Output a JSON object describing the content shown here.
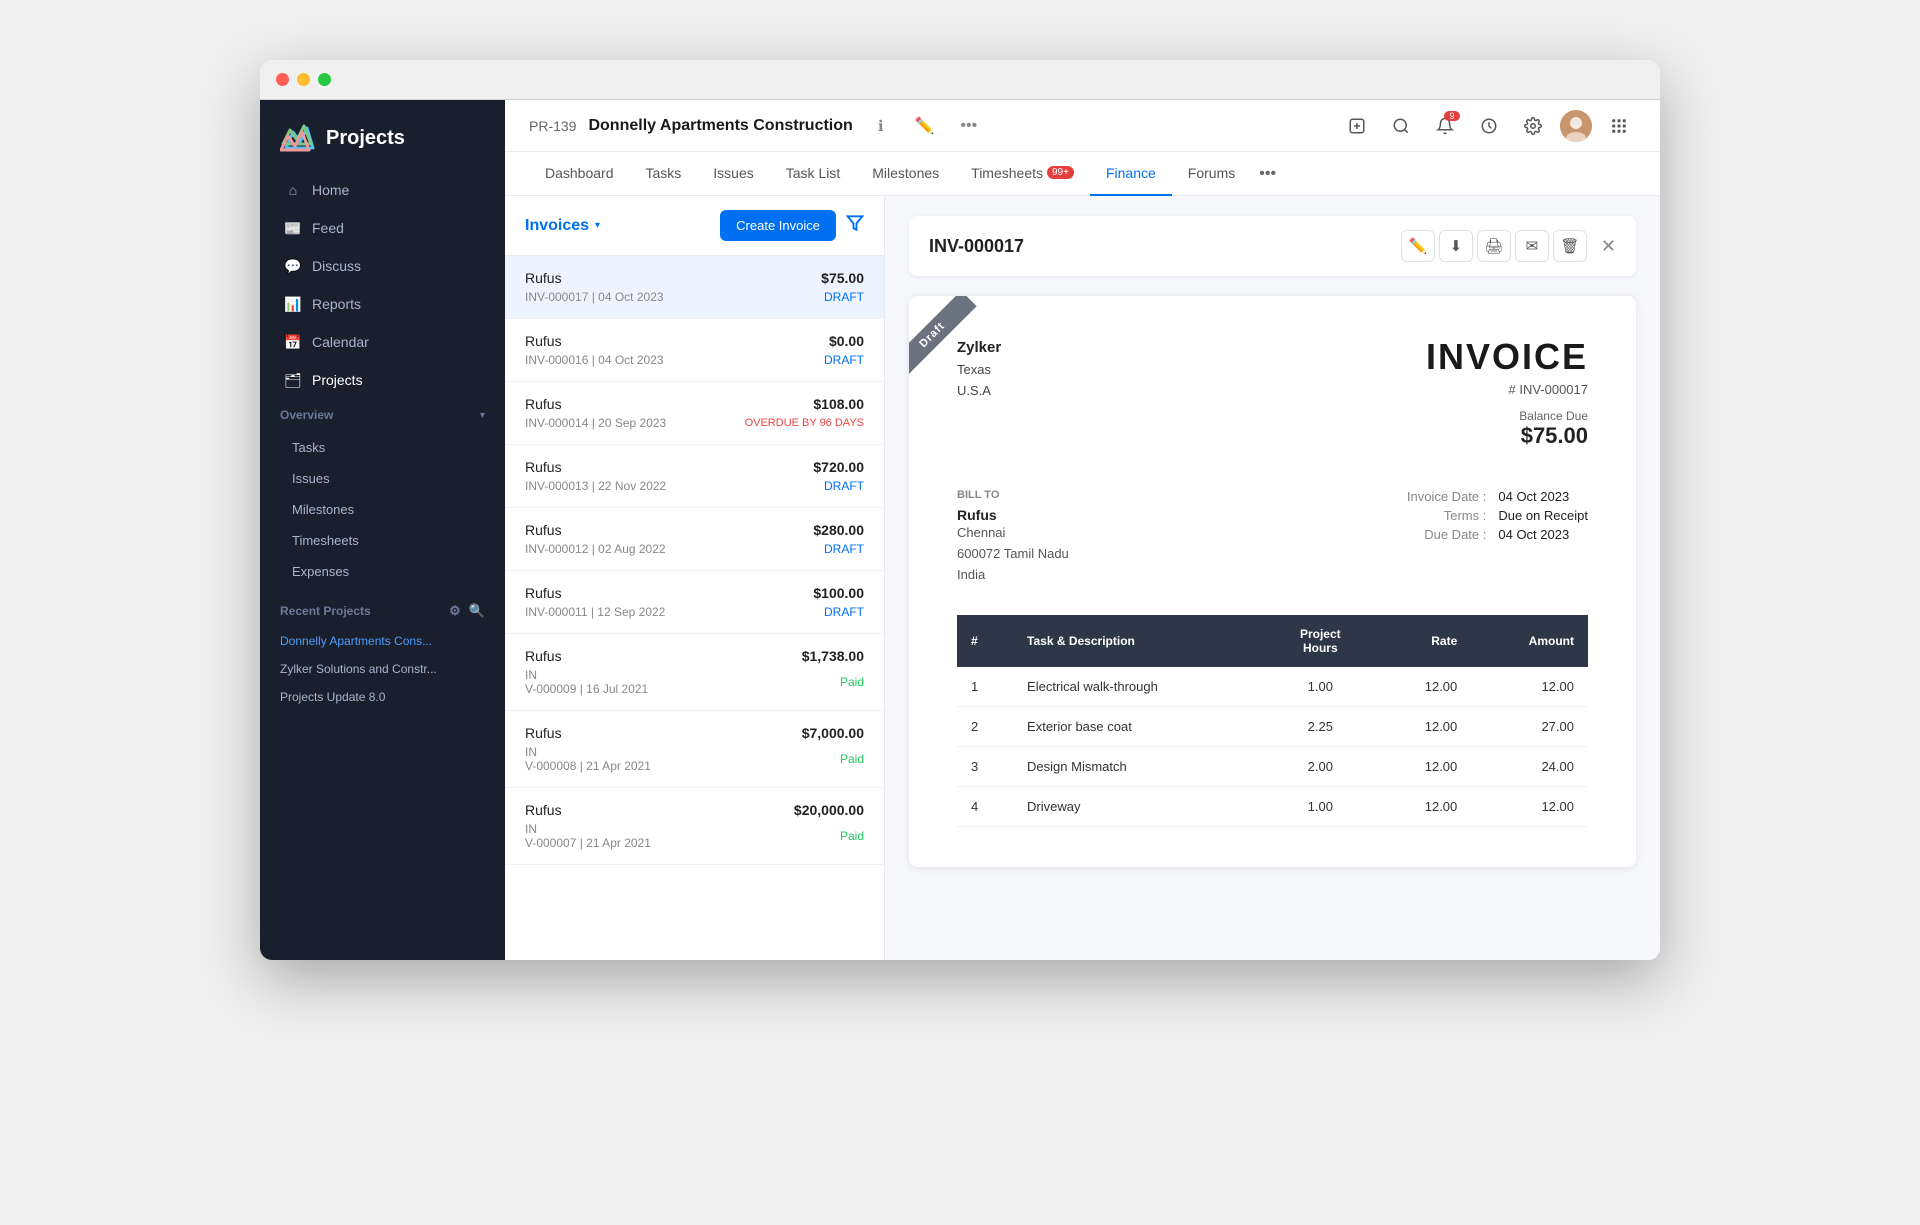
{
  "window": {
    "title": "Projects"
  },
  "sidebar": {
    "logo_text": "Projects",
    "nav_items": [
      {
        "id": "home",
        "label": "Home",
        "icon": "home"
      },
      {
        "id": "feed",
        "label": "Feed",
        "icon": "feed"
      },
      {
        "id": "discuss",
        "label": "Discuss",
        "icon": "discuss"
      },
      {
        "id": "reports",
        "label": "Reports",
        "icon": "reports"
      },
      {
        "id": "calendar",
        "label": "Calendar",
        "icon": "calendar"
      },
      {
        "id": "projects",
        "label": "Projects",
        "icon": "projects"
      }
    ],
    "overview_label": "Overview",
    "sub_nav": [
      {
        "label": "Tasks"
      },
      {
        "label": "Issues"
      },
      {
        "label": "Milestones"
      },
      {
        "label": "Timesheets"
      },
      {
        "label": "Expenses"
      }
    ],
    "recent_projects_label": "Recent Projects",
    "recent_projects": [
      {
        "label": "Donnelly Apartments Cons...",
        "active": true
      },
      {
        "label": "Zylker Solutions and Constr..."
      },
      {
        "label": "Projects Update 8.0"
      }
    ]
  },
  "header": {
    "project_code": "PR-139",
    "project_name": "Donnelly Apartments Construction",
    "tabs": [
      {
        "label": "Dashboard",
        "active": false
      },
      {
        "label": "Tasks",
        "active": false
      },
      {
        "label": "Issues",
        "active": false
      },
      {
        "label": "Task List",
        "active": false
      },
      {
        "label": "Milestones",
        "active": false
      },
      {
        "label": "Timesheets",
        "active": false,
        "badge": "99+"
      },
      {
        "label": "Finance",
        "active": true
      },
      {
        "label": "Forums",
        "active": false
      }
    ]
  },
  "finance": {
    "invoices_label": "Invoices",
    "create_invoice_btn": "Create Invoice",
    "invoices": [
      {
        "client": "Rufus",
        "ref": "INV-000017",
        "date": "04 Oct 2023",
        "amount": "$75.00",
        "status": "DRAFT",
        "status_type": "draft",
        "selected": true
      },
      {
        "client": "Rufus",
        "ref": "INV-000016",
        "date": "04 Oct 2023",
        "amount": "$0.00",
        "status": "DRAFT",
        "status_type": "draft",
        "selected": false
      },
      {
        "client": "Rufus",
        "ref": "INV-000014",
        "date": "20 Sep 2023",
        "amount": "$108.00",
        "status": "OVERDUE BY 96 DAYS",
        "status_type": "overdue",
        "selected": false
      },
      {
        "client": "Rufus",
        "ref": "INV-000013",
        "date": "22 Nov 2022",
        "amount": "$720.00",
        "status": "DRAFT",
        "status_type": "draft",
        "selected": false
      },
      {
        "client": "Rufus",
        "ref": "INV-000012",
        "date": "02 Aug 2022",
        "amount": "$280.00",
        "status": "DRAFT",
        "status_type": "draft",
        "selected": false
      },
      {
        "client": "Rufus",
        "ref": "INV-000011",
        "date": "12 Sep 2022",
        "amount": "$100.00",
        "status": "DRAFT",
        "status_type": "draft",
        "selected": false
      },
      {
        "client": "Rufus",
        "ref": "IN\nV-000009",
        "date": "16 Jul 2021",
        "amount": "$1,738.00",
        "status": "Paid",
        "status_type": "paid",
        "selected": false
      },
      {
        "client": "Rufus",
        "ref": "IN\nV-000008",
        "date": "21 Apr 2021",
        "amount": "$7,000.00",
        "status": "Paid",
        "status_type": "paid",
        "selected": false
      },
      {
        "client": "Rufus",
        "ref": "IN\nV-000007",
        "date": "21 Apr 2021",
        "amount": "$20,000.00",
        "status": "Paid",
        "status_type": "paid",
        "selected": false
      }
    ]
  },
  "invoice_detail": {
    "invoice_number": "INV-000017",
    "draft_label": "Draft",
    "sender": {
      "name": "Zylker",
      "line1": "Texas",
      "line2": "U.S.A"
    },
    "invoice_title": "INVOICE",
    "invoice_ref": "# INV-000017",
    "balance_due_label": "Balance Due",
    "balance_due": "$75.00",
    "bill_to_label": "Bill To",
    "bill_to": {
      "name": "Rufus",
      "line1": "Chennai",
      "line2": "600072 Tamil Nadu",
      "line3": "India"
    },
    "invoice_date_label": "Invoice Date :",
    "invoice_date": "04 Oct 2023",
    "terms_label": "Terms :",
    "terms": "Due on Receipt",
    "due_date_label": "Due Date :",
    "due_date": "04 Oct 2023",
    "table_headers": {
      "num": "#",
      "task": "Task & Description",
      "project_hours": "Project\nHours",
      "rate": "Rate",
      "amount": "Amount"
    },
    "line_items": [
      {
        "num": 1,
        "task": "Electrical walk-through",
        "hours": "1.00",
        "rate": "12.00",
        "amount": "12.00"
      },
      {
        "num": 2,
        "task": "Exterior base coat",
        "hours": "2.25",
        "rate": "12.00",
        "amount": "27.00"
      },
      {
        "num": 3,
        "task": "Design Mismatch",
        "hours": "2.00",
        "rate": "12.00",
        "amount": "24.00"
      },
      {
        "num": 4,
        "task": "Driveway",
        "hours": "1.00",
        "rate": "12.00",
        "amount": "12.00"
      }
    ]
  }
}
